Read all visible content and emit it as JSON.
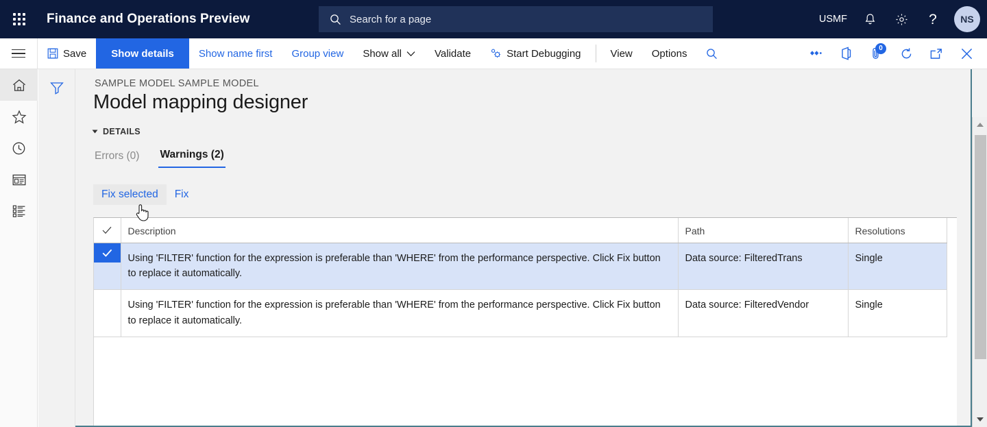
{
  "topbar": {
    "waffle_icon": "app-launcher-icon",
    "app_title": "Finance and Operations Preview",
    "search": {
      "icon": "search-icon",
      "placeholder": "Search for a page"
    },
    "company": "USMF",
    "notifications_icon": "bell-icon",
    "settings_icon": "gear-icon",
    "help_icon": "question-mark-icon",
    "avatar_initials": "NS"
  },
  "toolbar": {
    "hamburger_icon": "hamburger-menu-icon",
    "save_label": "Save",
    "save_icon": "save-disk-icon",
    "show_details_label": "Show details",
    "show_name_first_label": "Show name first",
    "group_view_label": "Group view",
    "show_all_label": "Show all",
    "show_all_caret_icon": "chevron-down-icon",
    "validate_label": "Validate",
    "start_debugging_label": "Start Debugging",
    "start_debugging_icon": "debug-gear-icon",
    "view_label": "View",
    "options_label": "Options",
    "search_icon": "search-icon",
    "right_icons": [
      {
        "name": "share-icon"
      },
      {
        "name": "office-app-icon"
      },
      {
        "name": "attachments-icon",
        "badge": "0"
      },
      {
        "name": "refresh-icon"
      },
      {
        "name": "popout-icon"
      },
      {
        "name": "close-icon"
      }
    ]
  },
  "rail": {
    "items": [
      {
        "name": "home-icon",
        "selected": true
      },
      {
        "name": "favorites-star-icon",
        "selected": false
      },
      {
        "name": "recent-clock-icon",
        "selected": false
      },
      {
        "name": "workspaces-icon",
        "selected": false
      },
      {
        "name": "modules-list-icon",
        "selected": false
      }
    ]
  },
  "filter_column": {
    "icon": "filter-funnel-icon"
  },
  "page": {
    "breadcrumb": "SAMPLE MODEL SAMPLE MODEL",
    "title": "Model mapping designer",
    "section_label": "DETAILS"
  },
  "tabs": [
    {
      "label": "Errors (0)",
      "active": false
    },
    {
      "label": "Warnings (2)",
      "active": true
    }
  ],
  "grid_actions": [
    {
      "label": "Fix selected",
      "hovered": true
    },
    {
      "label": "Fix",
      "hovered": false
    }
  ],
  "table": {
    "columns": [
      "Description",
      "Path",
      "Resolutions"
    ],
    "check_header_icon": "checkmark-icon",
    "rows": [
      {
        "selected": true,
        "check_icon": "checkmark-icon",
        "description": "Using 'FILTER' function for the expression is preferable than 'WHERE' from the performance perspective. Click Fix button to replace it automatically.",
        "path": "Data source: FilteredTrans",
        "resolutions": "Single"
      },
      {
        "selected": false,
        "check_icon": "",
        "description": "Using 'FILTER' function for the expression is preferable than 'WHERE' from the performance perspective. Click Fix button to replace it automatically.",
        "path": "Data source: FilteredVendor",
        "resolutions": "Single"
      }
    ]
  },
  "scrollbar": {
    "up_arrow_icon": "scroll-up-arrow-icon",
    "down_arrow_icon": "scroll-down-arrow-icon",
    "thumb": "scroll-thumb"
  },
  "cursor": {
    "type": "pointer-hand-cursor"
  },
  "colors": {
    "nav_background": "#0c1a3c",
    "nav_search_background": "#203259",
    "accent_blue": "#2266e3",
    "row_selected": "#d8e3f8",
    "page_background": "#f2f2f2",
    "panel_border": "#4a7d8c"
  }
}
